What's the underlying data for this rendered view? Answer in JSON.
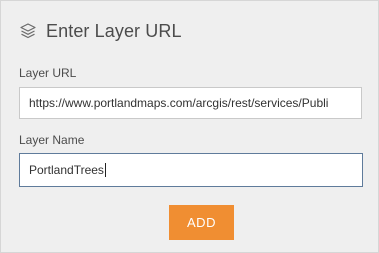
{
  "header": {
    "icon": "layers-icon",
    "title": "Enter Layer URL"
  },
  "form": {
    "url_label": "Layer URL",
    "url_value": "https://www.portlandmaps.com/arcgis/rest/services/Publi",
    "name_label": "Layer Name",
    "name_value": "PortlandTrees"
  },
  "actions": {
    "add_label": "ADD"
  },
  "colors": {
    "panel_bg": "#efefef",
    "accent_button": "#f08e32",
    "focus_border": "#5f7b9b"
  }
}
